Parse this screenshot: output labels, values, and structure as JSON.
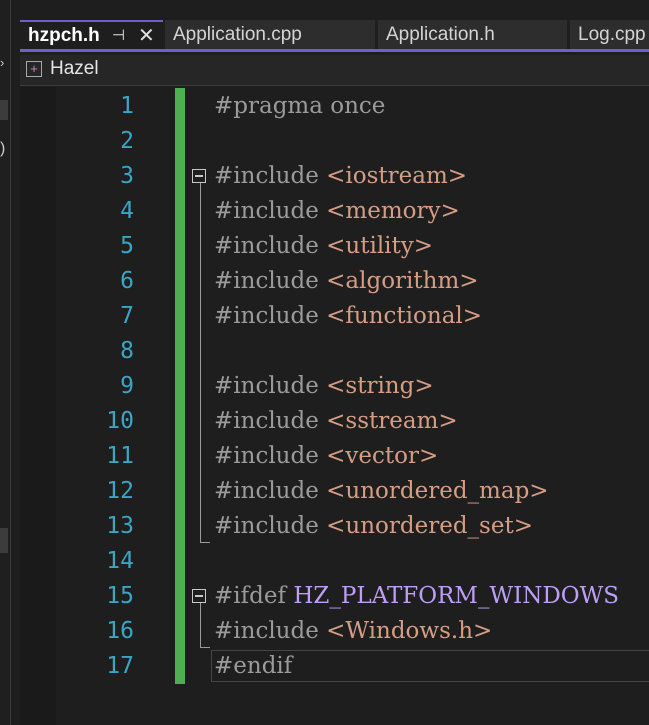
{
  "tabs": [
    {
      "label": "hzpch.h",
      "active": true,
      "pin_icon": "pin-icon",
      "close_icon": "close-icon"
    },
    {
      "label": "Application.cpp",
      "active": false
    },
    {
      "label": "Application.h",
      "active": false
    },
    {
      "label": "Log.cpp",
      "active": false
    }
  ],
  "pin_glyph": "⊣",
  "close_glyph": "✕",
  "navbar": {
    "project_icon": "project-icon",
    "project_name": "Hazel"
  },
  "sidebar_marks": {
    "m1": "›",
    "m3": ")"
  },
  "line_numbers": [
    "1",
    "2",
    "3",
    "4",
    "5",
    "6",
    "7",
    "8",
    "9",
    "10",
    "11",
    "12",
    "13",
    "14",
    "15",
    "16",
    "17"
  ],
  "code": [
    {
      "kw": "#pragma once",
      "rest": ""
    },
    {
      "kw": "",
      "rest": ""
    },
    {
      "kw": "#include ",
      "rest": "<iostream>"
    },
    {
      "kw": "#include ",
      "rest": "<memory>"
    },
    {
      "kw": "#include ",
      "rest": "<utility>"
    },
    {
      "kw": "#include ",
      "rest": "<algorithm>"
    },
    {
      "kw": "#include ",
      "rest": "<functional>"
    },
    {
      "kw": "",
      "rest": ""
    },
    {
      "kw": "#include ",
      "rest": "<string>"
    },
    {
      "kw": "#include ",
      "rest": "<sstream>"
    },
    {
      "kw": "#include ",
      "rest": "<vector>"
    },
    {
      "kw": "#include ",
      "rest": "<unordered_map>"
    },
    {
      "kw": "#include ",
      "rest": "<unordered_set>"
    },
    {
      "kw": "",
      "rest": ""
    },
    {
      "kw": "#ifdef ",
      "macro": "HZ_PLATFORM_WINDOWS"
    },
    {
      "kw": "#include ",
      "rest": "<Windows.h>"
    },
    {
      "kw": "#endif",
      "rest": ""
    }
  ],
  "colors": {
    "accent": "#6c5fd1",
    "line_number": "#3ba5c6",
    "header": "#d69d85",
    "macro": "#bd9ff5",
    "change_bar": "#4caf50"
  }
}
